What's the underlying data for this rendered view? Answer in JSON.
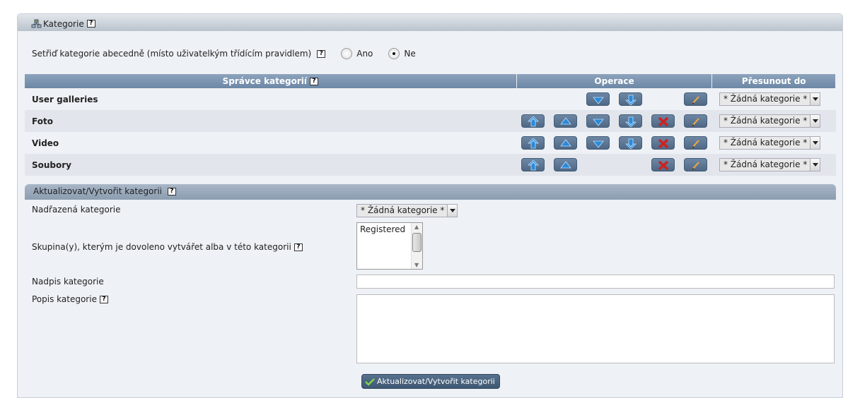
{
  "panel": {
    "title": "Kategorie"
  },
  "sort": {
    "label": "Setřiď kategorie abecedně (místo uživatelkým třídícím pravidlem)",
    "yes": "Ano",
    "no": "Ne",
    "selected": "Ne"
  },
  "table": {
    "headers": {
      "manager": "Správce kategorií",
      "operations": "Operace",
      "move_to": "Přesunout do"
    },
    "rows": [
      {
        "name": "User galleries",
        "ops": [
          "",
          "",
          "down",
          "bottom",
          "",
          "edit"
        ],
        "move": "* Žádná kategorie *"
      },
      {
        "name": "Foto",
        "ops": [
          "top",
          "up",
          "down",
          "bottom",
          "delete",
          "edit"
        ],
        "move": "* Žádná kategorie *"
      },
      {
        "name": "Video",
        "ops": [
          "top",
          "up",
          "down",
          "bottom",
          "delete",
          "edit"
        ],
        "move": "* Žádná kategorie *"
      },
      {
        "name": "Soubory",
        "ops": [
          "top",
          "up",
          "",
          "",
          "delete",
          "edit"
        ],
        "move": "* Žádná kategorie *"
      }
    ]
  },
  "form": {
    "title": "Aktualizovat/Vytvořit kategorii",
    "parent_label": "Nadřazená kategorie",
    "parent_value": "* Žádná kategorie *",
    "groups_label": "Skupina(y), kterým je dovoleno vytvářet alba v této kategorii",
    "groups_options": [
      "Registered"
    ],
    "title_label": "Nadpis kategorie",
    "title_value": "",
    "desc_label": "Popis kategorie",
    "desc_value": "",
    "submit_label": "Aktualizovat/Vytvořit kategorii"
  },
  "colors": {
    "header": "#7890ab",
    "button": "#5a7492",
    "arrow": "#2b8ad8",
    "delete": "#cc2222"
  }
}
